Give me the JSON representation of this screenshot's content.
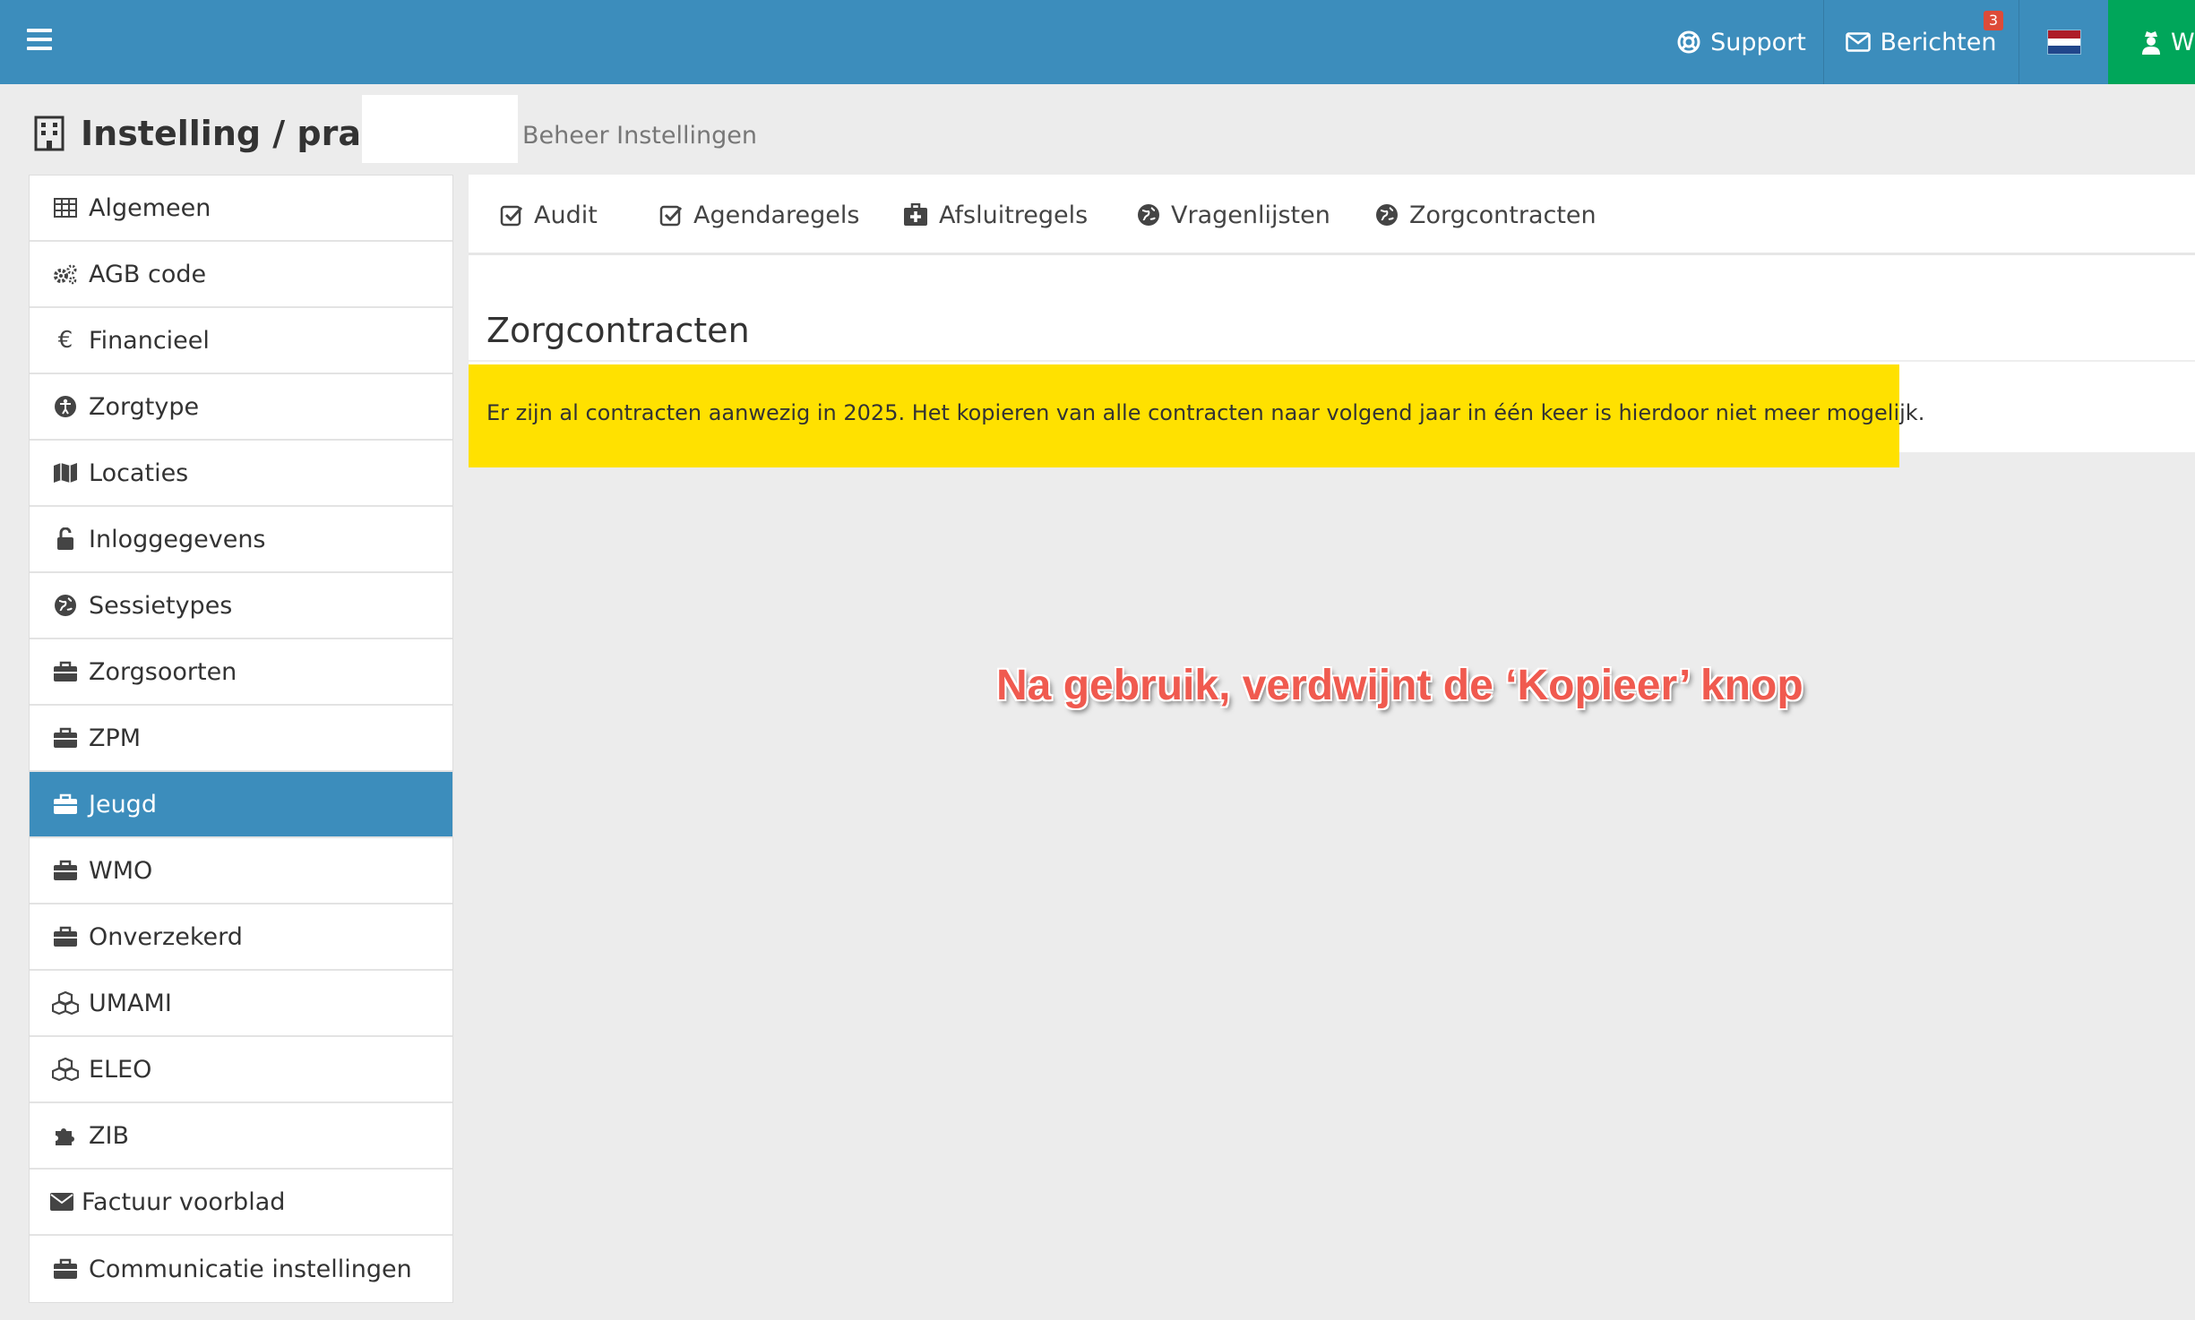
{
  "topbar": {
    "support_label": "Support",
    "berichten_label": "Berichten",
    "berichten_badge": "3",
    "user_label": "Wi",
    "colors": {
      "navbar": "#3c8dbc",
      "user": "#00a65a",
      "badge": "#dd4b39"
    }
  },
  "header": {
    "title": "Instelling / praktijk",
    "breadcrumb": "Beheer Instellingen"
  },
  "sidebar": {
    "items": [
      {
        "label": "Algemeen",
        "icon": "table-icon"
      },
      {
        "label": "AGB code",
        "icon": "cogs-icon"
      },
      {
        "label": "Financieel",
        "icon": "euro-icon"
      },
      {
        "label": "Zorgtype",
        "icon": "accessibility-icon"
      },
      {
        "label": "Locaties",
        "icon": "map-icon"
      },
      {
        "label": "Inloggegevens",
        "icon": "unlock-icon"
      },
      {
        "label": "Sessietypes",
        "icon": "globe-icon"
      },
      {
        "label": "Zorgsoorten",
        "icon": "briefcase-icon"
      },
      {
        "label": "ZPM",
        "icon": "briefcase-icon"
      },
      {
        "label": "Jeugd",
        "icon": "briefcase-icon",
        "active": true
      },
      {
        "label": "WMO",
        "icon": "briefcase-icon"
      },
      {
        "label": "Onverzekerd",
        "icon": "briefcase-icon"
      },
      {
        "label": "UMAMI",
        "icon": "cubes-icon"
      },
      {
        "label": "ELEO",
        "icon": "cubes-icon"
      },
      {
        "label": "ZIB",
        "icon": "puzzle-icon"
      },
      {
        "label": "Factuur voorblad",
        "icon": "envelope-icon"
      },
      {
        "label": "Communicatie instellingen",
        "icon": "briefcase-icon"
      }
    ]
  },
  "tabs": [
    {
      "label": "Audit",
      "icon": "check-square-icon"
    },
    {
      "label": "Agendaregels",
      "icon": "check-square-icon"
    },
    {
      "label": "Afsluitregels",
      "icon": "medkit-icon"
    },
    {
      "label": "Vragenlijsten",
      "icon": "globe-icon"
    },
    {
      "label": "Zorgcontracten",
      "icon": "globe-icon"
    }
  ],
  "main": {
    "section_title": "Zorgcontracten",
    "alert_text": "Er zijn al contracten aanwezig in 2025. Het kopieren van alle contracten naar volgend jaar in één keer is hierdoor niet meer mogelijk.",
    "alert_color": "#ffe100"
  },
  "annotation": "Na gebruik, verdwijnt de ‘Kopieer’ knop"
}
